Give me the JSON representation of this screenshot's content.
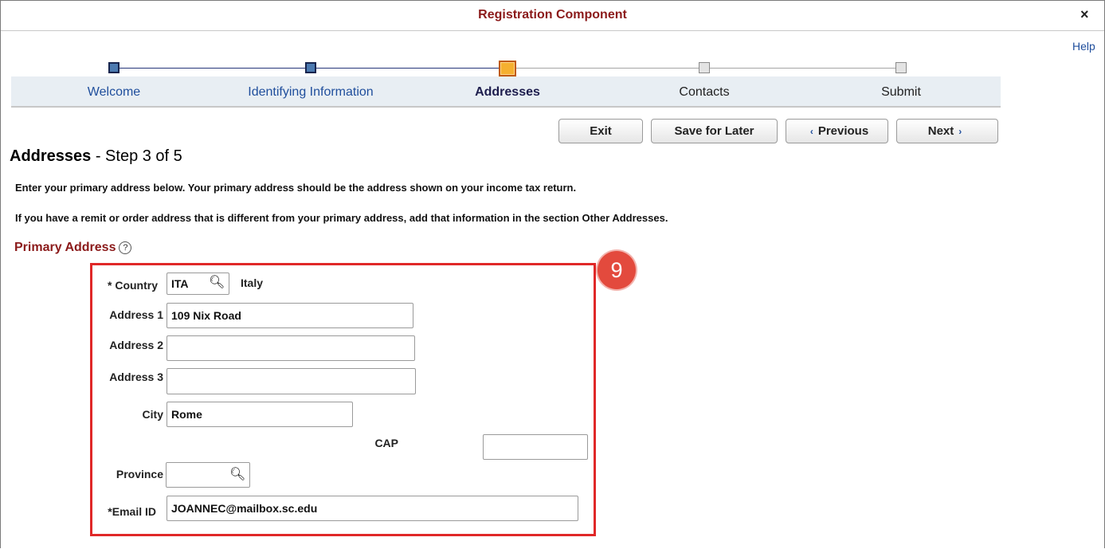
{
  "window": {
    "title": "Registration Component",
    "close_glyph": "×",
    "help": "Help"
  },
  "train": {
    "steps": [
      {
        "label": "Welcome",
        "state": "complete"
      },
      {
        "label": "Identifying Information",
        "state": "complete"
      },
      {
        "label": "Addresses",
        "state": "current"
      },
      {
        "label": "Contacts",
        "state": "incomplete"
      },
      {
        "label": "Submit",
        "state": "incomplete"
      }
    ]
  },
  "toolbar": {
    "exit": "Exit",
    "save_later": "Save for Later",
    "previous": "Previous",
    "next": "Next"
  },
  "page": {
    "title_bold": "Addresses",
    "title_rest": " - Step 3 of 5",
    "instruction_1": "Enter your primary address below. Your primary address should be the address shown on your income tax return.",
    "instruction_2": "If you have a remit or order address that is different from your primary address, add that information in the section Other Addresses.",
    "section_title": "Primary Address"
  },
  "callout": {
    "number": "9"
  },
  "form": {
    "country_label": "* Country",
    "country_value": "ITA",
    "country_desc": "Italy",
    "address1_label": "Address 1",
    "address1_value": "109 Nix Road",
    "address2_label": "Address 2",
    "address2_value": "",
    "address3_label": "Address 3",
    "address3_value": "",
    "city_label": "City",
    "city_value": "Rome",
    "cap_label": "CAP",
    "cap_value": "",
    "province_label": "Province",
    "province_value": "",
    "email_label": "*Email ID",
    "email_value": "JOANNEC@mailbox.sc.edu"
  },
  "colors": {
    "title_red": "#8b1a1a",
    "link_blue": "#1f4e9c",
    "callout_red": "#e02828",
    "current_step": "#f5b030"
  },
  "icons": [
    "close-icon",
    "search-icon",
    "help-icon",
    "chevron-left-icon",
    "chevron-right-icon"
  ]
}
